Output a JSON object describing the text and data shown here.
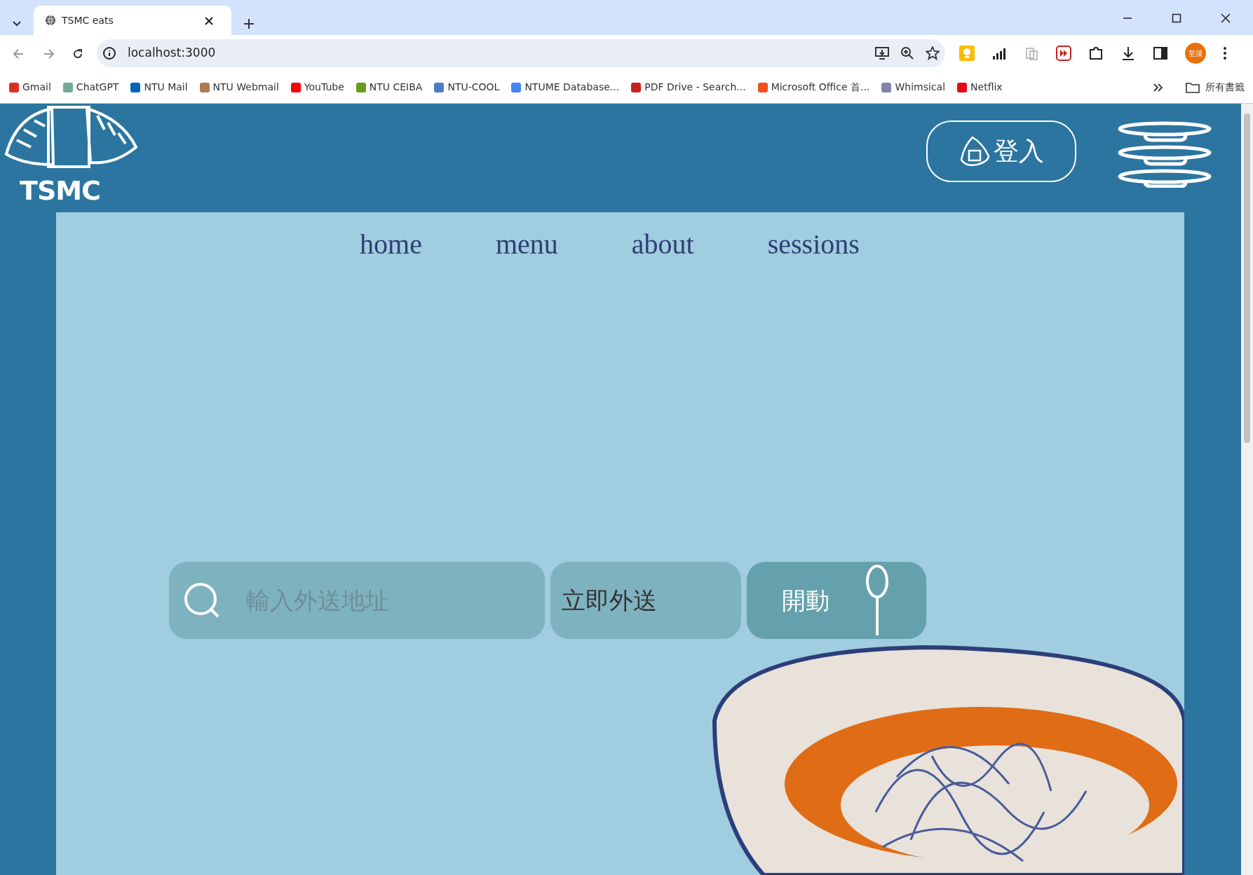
{
  "browser": {
    "tab_title": "TSMC eats",
    "url": "localhost:3000",
    "bookmarks": [
      "Gmail",
      "ChatGPT",
      "NTU Mail",
      "NTU Webmail",
      "YouTube",
      "NTU CEIBA",
      "NTU-COOL",
      "NTUME Database...",
      "PDF Drive - Search...",
      "Microsoft Office 首...",
      "Whimsical",
      "Netflix"
    ],
    "all_bookmarks": "所有書籤",
    "profile": "至漢"
  },
  "header": {
    "logo_text": "TSMC",
    "login_button": "登入"
  },
  "nav": [
    "home",
    "menu",
    "about",
    "sessions"
  ],
  "search": {
    "placeholder": "輸入外送地址",
    "mode": "立即外送",
    "go_button": "開動"
  }
}
